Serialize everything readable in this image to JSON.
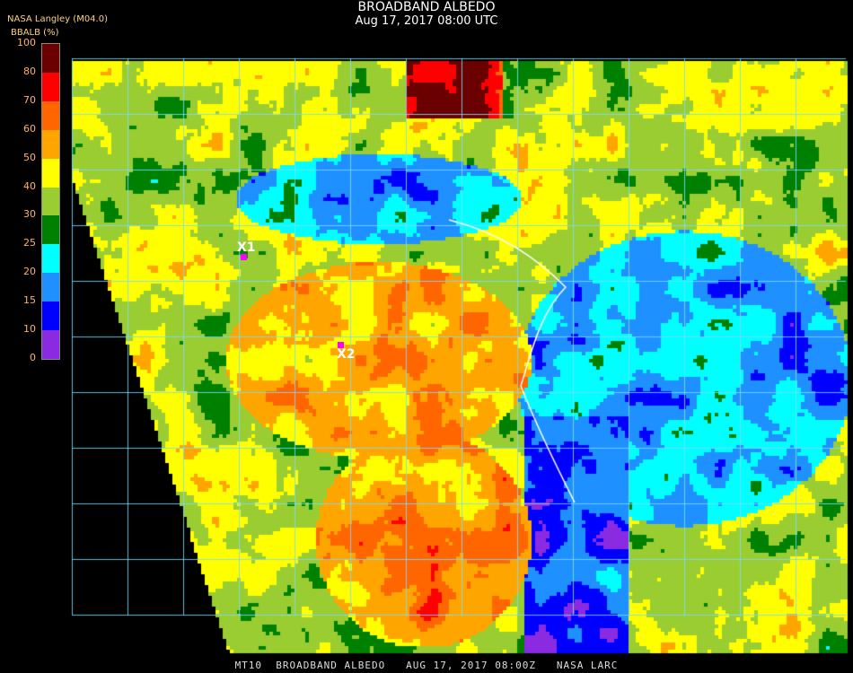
{
  "header": {
    "title": "BROADBAND ALBEDO",
    "subtitle": "Aug 17, 2017 08:00 UTC",
    "source": "NASA Langley (M04.0)"
  },
  "colorbar": {
    "label": "BBALB (%)",
    "ticks": [
      "100",
      "80",
      "70",
      "60",
      "50",
      "40",
      "30",
      "25",
      "20",
      "15",
      "10",
      "0"
    ],
    "colors": [
      "#6a0000",
      "#ff0000",
      "#ff6600",
      "#ffa500",
      "#ffff00",
      "#9acd32",
      "#008000",
      "#00ffff",
      "#1e90ff",
      "#0000ff",
      "#8a2be2"
    ]
  },
  "markers": [
    {
      "label": "X1"
    },
    {
      "label": "X2"
    }
  ],
  "footer": "MT10  BROADBAND ALBEDO   AUG 17, 2017 08:00Z   NASA LARC"
}
